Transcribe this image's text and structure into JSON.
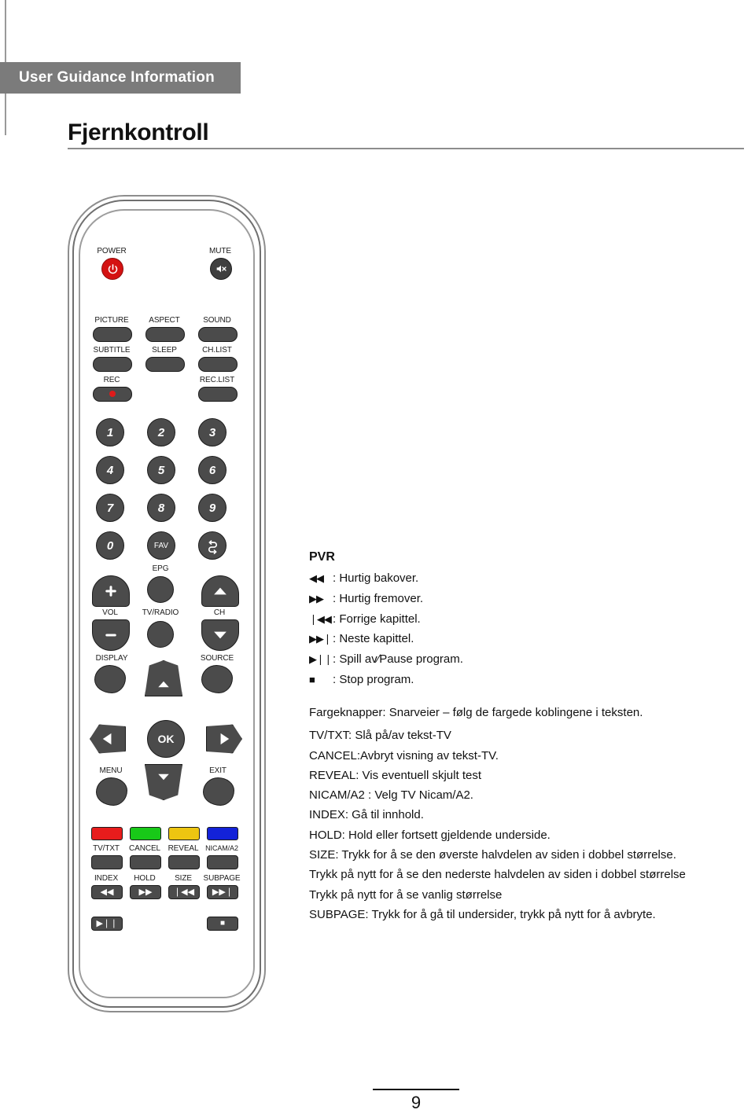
{
  "header": {
    "banner": "User Guidance Information",
    "title": "Fjernkontroll"
  },
  "remote": {
    "power_label": "POWER",
    "mute_label": "MUTE",
    "power_icon": "power-icon",
    "mute_icon": "mute-speaker-icon",
    "function_rows": [
      [
        "PICTURE",
        "ASPECT",
        "SOUND"
      ],
      [
        "SUBTITLE",
        "SLEEP",
        "CH.LIST"
      ]
    ],
    "rec_label": "REC",
    "reclist_label": "REC.LIST",
    "keypad": [
      "1",
      "2",
      "3",
      "4",
      "5",
      "6",
      "7",
      "8",
      "9",
      "0"
    ],
    "fav_label": "FAV",
    "recall_icon": "recall-swap-icon",
    "epg_label": "EPG",
    "vol_label": "VOL",
    "vol_up": "+",
    "vol_down": "−",
    "tvradio_label": "TV/RADIO",
    "ch_label": "CH",
    "ch_up": "▲",
    "ch_down": "▼",
    "display_label": "DISPLAY",
    "source_label": "SOURCE",
    "nav_up": "▲",
    "nav_down": "▼",
    "nav_left": "◀",
    "nav_right": "▶",
    "ok_label": "OK",
    "menu_label": "MENU",
    "exit_label": "EXIT",
    "color_buttons": [
      {
        "name": "red",
        "hex": "#e81c1c"
      },
      {
        "name": "green",
        "hex": "#18c918"
      },
      {
        "name": "yellow",
        "hex": "#edc511"
      },
      {
        "name": "blue",
        "hex": "#1322d8"
      }
    ],
    "teletext_labels": [
      "TV/TXT",
      "CANCEL",
      "REVEAL",
      "NICAM/A2"
    ],
    "transport_labels": [
      "INDEX",
      "HOLD",
      "SIZE",
      "SUBPAGE"
    ],
    "transport_glyphs": [
      "◀◀",
      "▶▶",
      "❘◀◀",
      "▶▶❘"
    ],
    "play_pause_glyph": "▶❘❘",
    "stop_glyph": "■"
  },
  "pvr": {
    "heading": "PVR",
    "rows": [
      {
        "glyph": "◀◀",
        "text": ": Hurtig bakover."
      },
      {
        "glyph": "▶▶",
        "text": ": Hurtig fremover."
      },
      {
        "glyph": "❘◀◀",
        "text": ": Forrige kapittel."
      },
      {
        "glyph": "▶▶❘",
        "text": ": Neste kapittel."
      },
      {
        "glyph": "▶❘❘",
        "text": ": Spill av∕Pause program."
      },
      {
        "glyph": "■",
        "text": ": Stop program."
      }
    ]
  },
  "description": {
    "lines": [
      "Fargeknapper: Snarveier – følg de fargede koblingene i teksten.",
      "TV/TXT: Slå på/av tekst-TV",
      "CANCEL:Avbryt visning av tekst-TV.",
      "REVEAL: Vis eventuell skjult test",
      "NICAM/A2 : Velg TV Nicam/A2.",
      "INDEX: Gå til innhold.",
      "HOLD: Hold eller fortsett gjeldende underside.",
      "SIZE: Trykk for å se den øverste halvdelen av siden i dobbel størrelse.",
      "Trykk på nytt for å se den nederste halvdelen av siden i dobbel størrelse",
      "Trykk på nytt for å se vanlig størrelse",
      "SUBPAGE: Trykk for å gå til undersider, trykk på nytt for å avbryte."
    ]
  },
  "footer": {
    "page_number": "9"
  }
}
